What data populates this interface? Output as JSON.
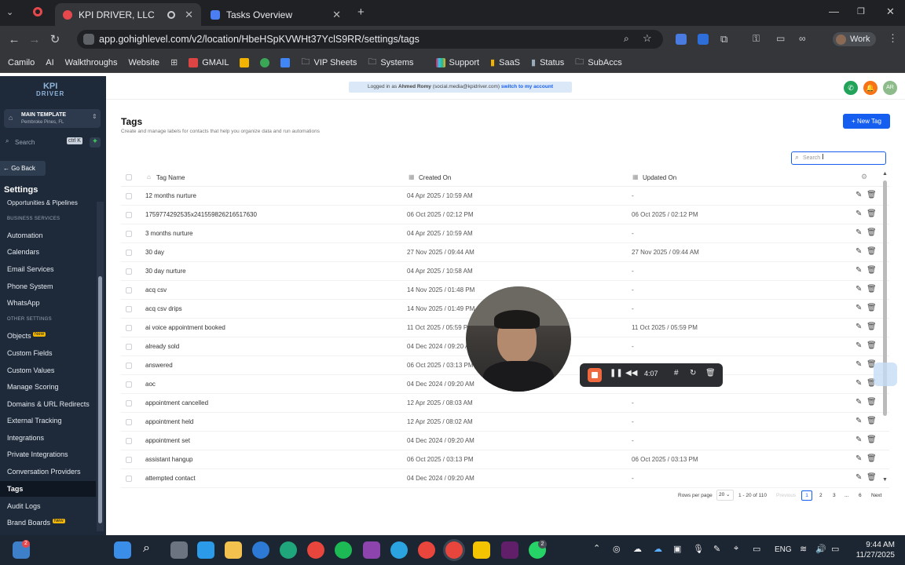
{
  "browser": {
    "tabs": [
      {
        "title": "KPI DRIVER, LLC"
      },
      {
        "title": "Tasks Overview"
      }
    ],
    "url": "app.gohighlevel.com/v2/location/HbeHSpKVWHt37YclS9RR/settings/tags",
    "profile": "Work",
    "bookmarks": [
      "Camilo",
      "AI",
      "Walkthroughs",
      "Website",
      "GMAIL",
      "VIP Sheets",
      "Systems",
      "Support",
      "SaaS",
      "Status",
      "SubAccs"
    ]
  },
  "banner": {
    "prefix": "Logged in as",
    "user": "Ahmed Romy",
    "email": "(social.media@kpidriver.com)",
    "switch": "switch to my account"
  },
  "header": {
    "avatar": "AR"
  },
  "sidebar": {
    "logo_line1": "KPI",
    "logo_line2": "DRIVER",
    "account_name": "MAIN TEMPLATE",
    "account_location": "Pembroke Pines, FL",
    "search_placeholder": "Search",
    "search_shortcut": "ctrl K",
    "go_back": "Go Back",
    "settings_title": "Settings",
    "items_top": [
      "Opportunities & Pipelines"
    ],
    "section_business": "BUSINESS SERVICES",
    "items_business": [
      "Automation",
      "Calendars",
      "Email Services",
      "Phone System",
      "WhatsApp"
    ],
    "section_other": "OTHER SETTINGS",
    "items_other": [
      "Objects",
      "Custom Fields",
      "Custom Values",
      "Manage Scoring",
      "Domains & URL Redirects",
      "External Tracking",
      "Integrations",
      "Private Integrations",
      "Conversation Providers",
      "Tags",
      "Audit Logs",
      "Brand Boards"
    ],
    "badge_new": "New",
    "active_item": "Tags"
  },
  "page": {
    "title": "Tags",
    "subtitle": "Create and manage labels for contacts that help you organize data and run automations",
    "new_tag_button": "New Tag",
    "search_placeholder": "Search"
  },
  "table": {
    "columns": [
      "Tag Name",
      "Created On",
      "Updated On"
    ],
    "rows": [
      {
        "name": "12 months nurture",
        "created": "04 Apr 2025 / 10:59 AM",
        "updated": "-"
      },
      {
        "name": "1759774292535x241559826216517630",
        "created": "06 Oct 2025 / 02:12 PM",
        "updated": "06 Oct 2025 / 02:12 PM"
      },
      {
        "name": "3 months nurture",
        "created": "04 Apr 2025 / 10:59 AM",
        "updated": "-"
      },
      {
        "name": "30 day",
        "created": "27 Nov 2025 / 09:44 AM",
        "updated": "27 Nov 2025 / 09:44 AM"
      },
      {
        "name": "30 day nurture",
        "created": "04 Apr 2025 / 10:58 AM",
        "updated": "-"
      },
      {
        "name": "acq csv",
        "created": "14 Nov 2025 / 01:48 PM",
        "updated": "-"
      },
      {
        "name": "acq csv drips",
        "created": "14 Nov 2025 / 01:49 PM",
        "updated": "-"
      },
      {
        "name": "ai voice appointment booked",
        "created": "11 Oct 2025 / 05:59 PM",
        "updated": "11 Oct 2025 / 05:59 PM"
      },
      {
        "name": "already sold",
        "created": "04 Dec 2024 / 09:20 AM",
        "updated": "-"
      },
      {
        "name": "answered",
        "created": "06 Oct 2025 / 03:13 PM",
        "updated": "-"
      },
      {
        "name": "aoc",
        "created": "04 Dec 2024 / 09:20 AM",
        "updated": "-"
      },
      {
        "name": "appointment cancelled",
        "created": "12 Apr 2025 / 08:03 AM",
        "updated": "-"
      },
      {
        "name": "appointment held",
        "created": "12 Apr 2025 / 08:02 AM",
        "updated": "-"
      },
      {
        "name": "appointment set",
        "created": "04 Dec 2024 / 09:20 AM",
        "updated": "-"
      },
      {
        "name": "assistant hangup",
        "created": "06 Oct 2025 / 03:13 PM",
        "updated": "06 Oct 2025 / 03:13 PM"
      },
      {
        "name": "attempted contact",
        "created": "04 Dec 2024 / 09:20 AM",
        "updated": "-"
      }
    ]
  },
  "pagination": {
    "rows_label": "Rows per page",
    "rows_value": "20",
    "range": "1 - 20 of 110",
    "previous": "Previous",
    "pages": [
      "1",
      "2",
      "3",
      "...",
      "6"
    ],
    "next": "Next"
  },
  "recorder": {
    "time": "4:07"
  },
  "taskbar": {
    "lang": "ENG",
    "time": "9:44 AM",
    "date": "11/27/2025",
    "badge1": "2",
    "badge2": "2"
  },
  "colors": {
    "sidebar_bg": "#1e2a3a",
    "accent": "#155eef",
    "active_item_bg": "#0f1722"
  }
}
